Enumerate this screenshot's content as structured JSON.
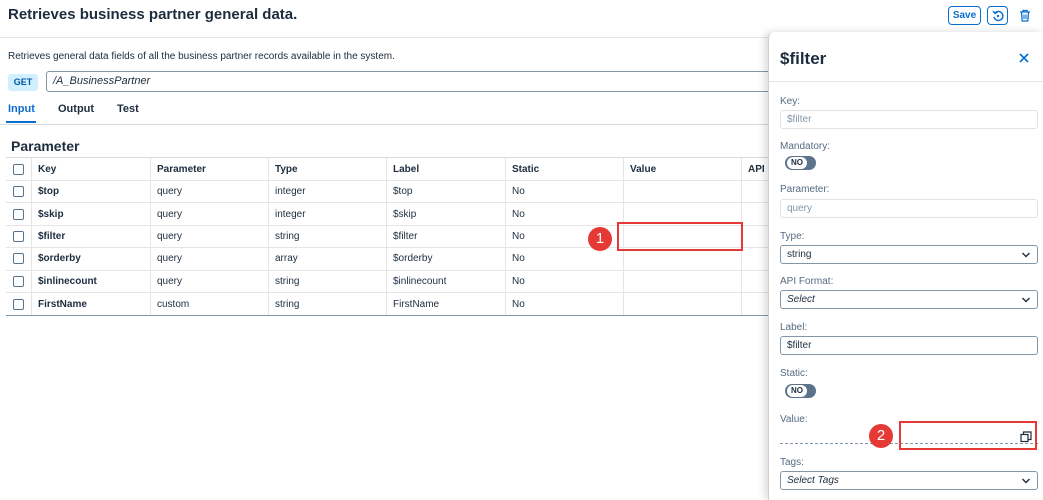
{
  "header": {
    "title": "Retrieves business partner general data.",
    "save_label": "Save",
    "buttons": {
      "restore_icon": "restore-icon",
      "delete_icon": "trash-icon"
    }
  },
  "description": "Retrieves general data fields of all the business partner records available in the system.",
  "request": {
    "method": "GET",
    "path": "/A_BusinessPartner"
  },
  "tabs": [
    {
      "label": "Input",
      "active": true
    },
    {
      "label": "Output",
      "active": false
    },
    {
      "label": "Test",
      "active": false
    }
  ],
  "parameters": {
    "title": "Parameter",
    "columns": [
      "Key",
      "Parameter",
      "Type",
      "Label",
      "Static",
      "Value",
      "API F"
    ],
    "rows": [
      {
        "key": "$top",
        "parameter": "query",
        "type": "integer",
        "label": "$top",
        "static": "No",
        "value": ""
      },
      {
        "key": "$skip",
        "parameter": "query",
        "type": "integer",
        "label": "$skip",
        "static": "No",
        "value": ""
      },
      {
        "key": "$filter",
        "parameter": "query",
        "type": "string",
        "label": "$filter",
        "static": "No",
        "value": ""
      },
      {
        "key": "$orderby",
        "parameter": "query",
        "type": "array",
        "label": "$orderby",
        "static": "No",
        "value": ""
      },
      {
        "key": "$inlinecount",
        "parameter": "query",
        "type": "string",
        "label": "$inlinecount",
        "static": "No",
        "value": ""
      },
      {
        "key": "FirstName",
        "parameter": "custom",
        "type": "string",
        "label": "FirstName",
        "static": "No",
        "value": ""
      }
    ]
  },
  "annotations": {
    "badge1": "1",
    "badge2": "2",
    "color": "#e53935"
  },
  "panel": {
    "title": "$filter",
    "key_label": "Key:",
    "key_placeholder": "$filter",
    "mandatory_label": "Mandatory:",
    "mandatory_toggle": "NO",
    "parameter_label": "Parameter:",
    "parameter_value": "query",
    "type_label": "Type:",
    "type_value": "string",
    "api_format_label": "API Format:",
    "api_format_value": "Select",
    "label_label": "Label:",
    "label_value": "$filter",
    "static_label": "Static:",
    "static_toggle": "NO",
    "value_label": "Value:",
    "value_value": "",
    "tags_label": "Tags:",
    "tags_value": "Select Tags"
  },
  "colors": {
    "accent": "#0a6ed1",
    "get_badge_bg": "#d1efff",
    "toggle_off": "#5b738b"
  }
}
